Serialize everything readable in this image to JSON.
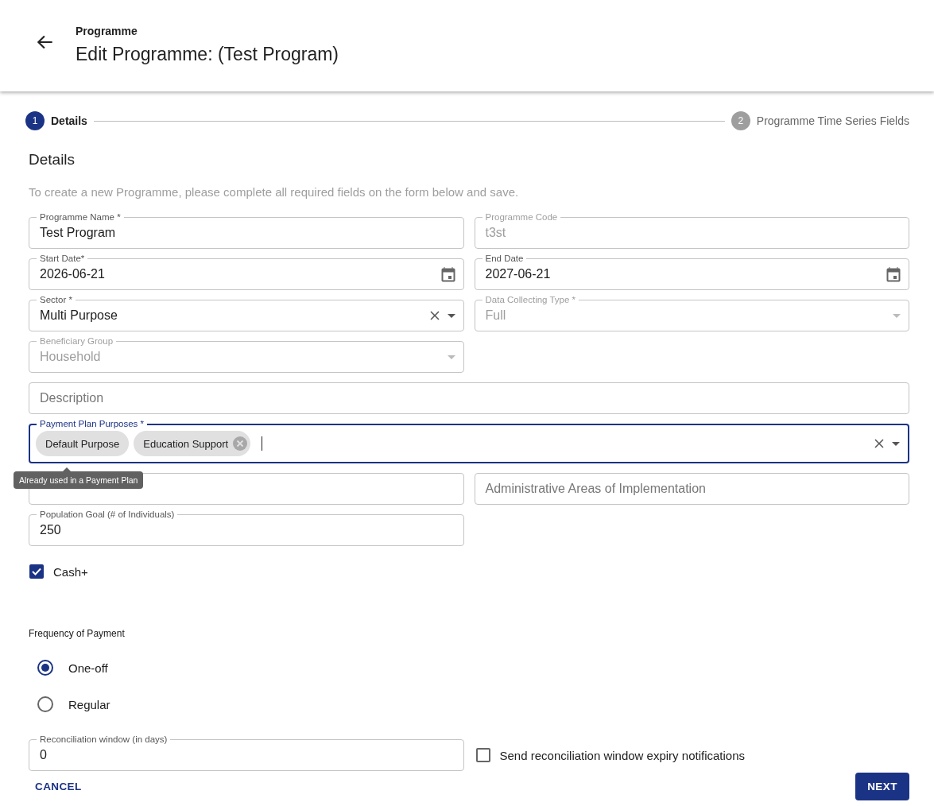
{
  "header": {
    "breadcrumb": "Programme",
    "title": "Edit Programme: (Test Program)"
  },
  "stepper": [
    {
      "number": "1",
      "label": "Details",
      "selected": true
    },
    {
      "number": "2",
      "label": "Programme Time Series Fields",
      "selected": false
    }
  ],
  "section": {
    "title": "Details",
    "description": "To create a new Programme, please complete all required fields on the form below and save."
  },
  "fields": [
    {
      "kind": "text",
      "label": "Programme Name *",
      "value": "Test Program",
      "disabled": false,
      "full": false
    },
    {
      "kind": "text",
      "label": "Programme Code",
      "value": "t3st",
      "disabled": true,
      "full": false
    },
    {
      "kind": "date",
      "label": "Start Date*",
      "value": "2026-06-21",
      "disabled": false,
      "full": false
    },
    {
      "kind": "date",
      "label": "End Date",
      "value": "2027-06-21",
      "disabled": false,
      "full": false
    },
    {
      "kind": "select",
      "label": "Sector *",
      "value": "Multi Purpose",
      "disabled": false,
      "clearable": true,
      "full": false
    },
    {
      "kind": "select",
      "label": "Data Collecting Type *",
      "value": "Full",
      "disabled": true,
      "full": false
    },
    {
      "kind": "select",
      "label": "Beneficiary Group",
      "value": "Household",
      "disabled": true,
      "full": false
    },
    {
      "kind": "gap"
    },
    {
      "kind": "text",
      "placeholder": "Description",
      "disabled": false,
      "full": true
    },
    {
      "kind": "chips",
      "label": "Payment Plan Purposes *",
      "focused": true,
      "clearable": true,
      "disabled": false,
      "full": true,
      "chips": [
        {
          "label": "Default Purpose",
          "removable": false
        },
        {
          "label": "Education Support",
          "removable": true
        }
      ],
      "tooltip": "Already used in a Payment Plan"
    },
    {
      "kind": "text",
      "full": false
    },
    {
      "kind": "text",
      "placeholder": "Administrative Areas of Implementation",
      "disabled": false,
      "full": false
    },
    {
      "kind": "text",
      "label": "Population Goal (# of Individuals)",
      "value": "250",
      "disabled": false,
      "full": false
    }
  ],
  "cash_plus": {
    "label": "Cash+",
    "checked": true
  },
  "frequency": {
    "title": "Frequency of Payment",
    "options": [
      {
        "label": "One-off",
        "selected": true
      },
      {
        "label": "Regular",
        "selected": false
      }
    ]
  },
  "reconciliation": {
    "label": "Reconciliation window (in days)",
    "value": "0"
  },
  "notifications": {
    "label": "Send reconciliation window expiry notifications",
    "checked": false
  },
  "buttons": {
    "cancel": "CANCEL",
    "next": "NEXT"
  }
}
